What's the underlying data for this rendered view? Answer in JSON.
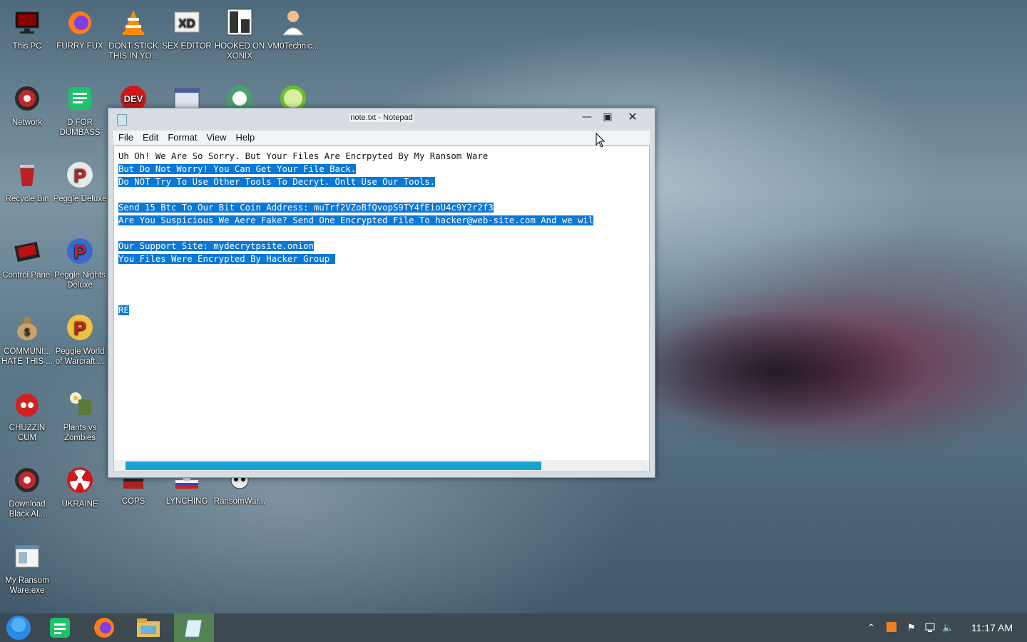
{
  "desktop": {
    "icons": [
      {
        "label": "This PC",
        "icon": "monitor-icon"
      },
      {
        "label": "FURRY FUX",
        "icon": "firefox-icon"
      },
      {
        "label": "DONT STICK THIS IN YO...",
        "icon": "vlc-cone-icon"
      },
      {
        "label": "SEX EDITOR",
        "icon": "hxd-icon"
      },
      {
        "label": "HOOKED ON XONIX",
        "icon": "xonix-icon"
      },
      {
        "label": "VM0Technic...",
        "icon": "doctor-icon"
      },
      {
        "label": "Network",
        "icon": "network-icon"
      },
      {
        "label": "D FOR DUMBASS",
        "icon": "green-doc-icon"
      },
      {
        "label": "",
        "icon": "devcpp-icon"
      },
      {
        "label": "",
        "icon": "window-app-icon"
      },
      {
        "label": "",
        "icon": "globe-icon"
      },
      {
        "label": "",
        "icon": "lime-icon"
      },
      {
        "label": "Recycle Bin",
        "icon": "recycle-bin-icon"
      },
      {
        "label": "Peggle Deluxe",
        "icon": "peggle-icon"
      },
      {
        "label": "Control Panel",
        "icon": "control-panel-icon"
      },
      {
        "label": "Peggle Nights Deluxe",
        "icon": "peggle-nights-icon"
      },
      {
        "label": "COMMUNI... HATE THIS ...",
        "icon": "money-bag-icon"
      },
      {
        "label": "Peggle World of Warcraft ...",
        "icon": "peggle-wow-icon"
      },
      {
        "label": "CHUZZIN CUM",
        "icon": "chuzzle-icon"
      },
      {
        "label": "Plants vs Zombies",
        "icon": "plants-icon"
      },
      {
        "label": "Download Black Al...",
        "icon": "download-icon"
      },
      {
        "label": "UKRAINE",
        "icon": "radiation-icon"
      },
      {
        "label": "COPS",
        "icon": "cops-icon"
      },
      {
        "label": "LYNCHING",
        "icon": "lynching-icon"
      },
      {
        "label": "RansomWar...",
        "icon": "skull-icon"
      },
      {
        "label": "My Ransom Ware.exe",
        "icon": "exe-icon"
      }
    ]
  },
  "notepad": {
    "title": "note.txt - Notepad",
    "menu": [
      "File",
      "Edit",
      "Format",
      "View",
      "Help"
    ],
    "lines": [
      {
        "text": "Uh Oh! We Are So Sorry. But Your Files Are Encrpyted By My Ransom Ware",
        "selected": false
      },
      {
        "text": "But Do Not Worry! You Can Get Your File Back.",
        "selected": true
      },
      {
        "text": "Do NOT Try To Use Other Tools To Decryt. Onlt Use Our Tools.",
        "selected": true
      },
      {
        "text": "",
        "selected": false
      },
      {
        "text": "Send 15 Btc To Our Bit Coin Address: muTrf2VZoBfQvopS9TY4fEioU4c9Y2r2f3",
        "selected": true
      },
      {
        "text": "Are You Suspicious We Aere Fake? Send One Encrypted File To hacker@web-site.com And we wil",
        "selected": true
      },
      {
        "text": "",
        "selected": false
      },
      {
        "text": "Our Support Site: mydecrytpsite.onion",
        "selected": true
      },
      {
        "text": "You Files Were Encrypted By Hacker Group ",
        "selected": true
      },
      {
        "text": "",
        "selected": false
      },
      {
        "text": "",
        "selected": false
      },
      {
        "text": "",
        "selected": false
      },
      {
        "text": "RE",
        "selected": true
      }
    ]
  },
  "taskbar": {
    "clock": "11:17 AM",
    "items": [
      "start-orb-icon",
      "green-doc-icon",
      "firefox-icon",
      "file-explorer-icon",
      "notepad-icon"
    ]
  },
  "colors": {
    "selection": "#0a78d7",
    "scroll_thumb": "#1aa2d2"
  }
}
